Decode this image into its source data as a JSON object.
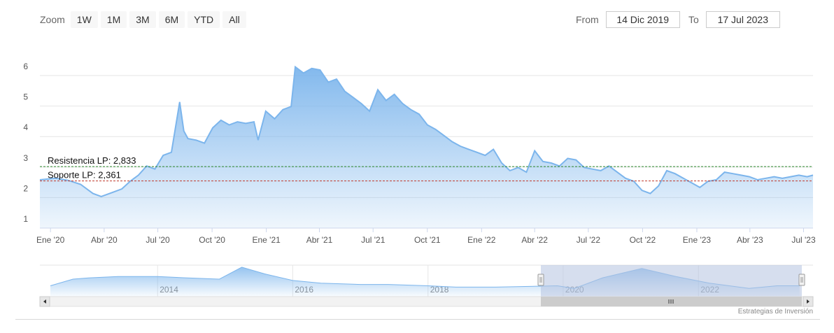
{
  "zoom": {
    "label": "Zoom",
    "buttons": [
      "1W",
      "1M",
      "3M",
      "6M",
      "YTD",
      "All"
    ]
  },
  "range": {
    "from_label": "From",
    "from_value": "14 Dic 2019",
    "to_label": "To",
    "to_value": "17 Jul 2023"
  },
  "credit": "Estrategias de Inversión",
  "colors": {
    "line": "#7cb5ec",
    "resistance": "#2e8b2e",
    "support": "#c0392b",
    "navigator_mask": "#b4c3e0"
  },
  "chart_data": {
    "type": "area",
    "title": "",
    "xlabel": "",
    "ylabel": "",
    "x_range": [
      "2019-12-14",
      "2023-07-17"
    ],
    "ylim": [
      1,
      6
    ],
    "yticks": [
      "1",
      "2",
      "3",
      "4",
      "5",
      "6"
    ],
    "xticks": [
      {
        "date": "2020-01-01",
        "label": "Ene '20"
      },
      {
        "date": "2020-04-01",
        "label": "Abr '20"
      },
      {
        "date": "2020-07-01",
        "label": "Jul '20"
      },
      {
        "date": "2020-10-01",
        "label": "Oct '20"
      },
      {
        "date": "2021-01-01",
        "label": "Ene '21"
      },
      {
        "date": "2021-04-01",
        "label": "Abr '21"
      },
      {
        "date": "2021-07-01",
        "label": "Jul '21"
      },
      {
        "date": "2021-10-01",
        "label": "Oct '21"
      },
      {
        "date": "2022-01-01",
        "label": "Ene '22"
      },
      {
        "date": "2022-04-01",
        "label": "Abr '22"
      },
      {
        "date": "2022-07-01",
        "label": "Jul '22"
      },
      {
        "date": "2022-10-01",
        "label": "Oct '22"
      },
      {
        "date": "2023-01-01",
        "label": "Ene '23"
      },
      {
        "date": "2023-04-01",
        "label": "Abr '23"
      },
      {
        "date": "2023-07-01",
        "label": "Jul '23"
      }
    ],
    "grid": true,
    "series": [
      {
        "points": [
          [
            "2019-12-14",
            2.4
          ],
          [
            "2020-01-10",
            2.45
          ],
          [
            "2020-01-31",
            2.38
          ],
          [
            "2020-02-21",
            2.25
          ],
          [
            "2020-03-13",
            1.95
          ],
          [
            "2020-03-27",
            1.85
          ],
          [
            "2020-04-17",
            2.0
          ],
          [
            "2020-05-01",
            2.1
          ],
          [
            "2020-05-15",
            2.35
          ],
          [
            "2020-05-29",
            2.55
          ],
          [
            "2020-06-12",
            2.85
          ],
          [
            "2020-06-26",
            2.75
          ],
          [
            "2020-07-10",
            3.2
          ],
          [
            "2020-07-24",
            3.3
          ],
          [
            "2020-08-07",
            4.95
          ],
          [
            "2020-08-14",
            4.0
          ],
          [
            "2020-08-21",
            3.75
          ],
          [
            "2020-09-04",
            3.7
          ],
          [
            "2020-09-18",
            3.6
          ],
          [
            "2020-10-02",
            4.1
          ],
          [
            "2020-10-16",
            4.35
          ],
          [
            "2020-10-30",
            4.2
          ],
          [
            "2020-11-13",
            4.3
          ],
          [
            "2020-11-27",
            4.25
          ],
          [
            "2020-12-11",
            4.3
          ],
          [
            "2020-12-18",
            3.7
          ],
          [
            "2020-12-31",
            4.65
          ],
          [
            "2021-01-15",
            4.4
          ],
          [
            "2021-01-29",
            4.7
          ],
          [
            "2021-02-12",
            4.8
          ],
          [
            "2021-02-19",
            6.1
          ],
          [
            "2021-03-05",
            5.9
          ],
          [
            "2021-03-19",
            6.05
          ],
          [
            "2021-04-02",
            6.0
          ],
          [
            "2021-04-16",
            5.6
          ],
          [
            "2021-04-30",
            5.7
          ],
          [
            "2021-05-14",
            5.3
          ],
          [
            "2021-05-28",
            5.1
          ],
          [
            "2021-06-11",
            4.9
          ],
          [
            "2021-06-25",
            4.65
          ],
          [
            "2021-07-09",
            5.35
          ],
          [
            "2021-07-23",
            5.0
          ],
          [
            "2021-08-06",
            5.2
          ],
          [
            "2021-08-20",
            4.9
          ],
          [
            "2021-09-03",
            4.7
          ],
          [
            "2021-09-17",
            4.55
          ],
          [
            "2021-10-01",
            4.2
          ],
          [
            "2021-10-15",
            4.05
          ],
          [
            "2021-10-29",
            3.85
          ],
          [
            "2021-11-12",
            3.65
          ],
          [
            "2021-11-26",
            3.5
          ],
          [
            "2021-12-10",
            3.4
          ],
          [
            "2021-12-24",
            3.3
          ],
          [
            "2022-01-07",
            3.2
          ],
          [
            "2022-01-21",
            3.4
          ],
          [
            "2022-02-04",
            2.95
          ],
          [
            "2022-02-18",
            2.7
          ],
          [
            "2022-03-04",
            2.8
          ],
          [
            "2022-03-18",
            2.65
          ],
          [
            "2022-04-01",
            3.35
          ],
          [
            "2022-04-15",
            3.0
          ],
          [
            "2022-04-29",
            2.95
          ],
          [
            "2022-05-13",
            2.85
          ],
          [
            "2022-05-27",
            3.1
          ],
          [
            "2022-06-10",
            3.05
          ],
          [
            "2022-06-24",
            2.8
          ],
          [
            "2022-07-08",
            2.75
          ],
          [
            "2022-07-22",
            2.7
          ],
          [
            "2022-08-05",
            2.85
          ],
          [
            "2022-08-19",
            2.65
          ],
          [
            "2022-09-02",
            2.45
          ],
          [
            "2022-09-16",
            2.35
          ],
          [
            "2022-09-30",
            2.05
          ],
          [
            "2022-10-14",
            1.95
          ],
          [
            "2022-10-28",
            2.2
          ],
          [
            "2022-11-11",
            2.7
          ],
          [
            "2022-11-25",
            2.6
          ],
          [
            "2022-12-09",
            2.45
          ],
          [
            "2022-12-23",
            2.3
          ],
          [
            "2023-01-06",
            2.15
          ],
          [
            "2023-01-20",
            2.35
          ],
          [
            "2023-02-03",
            2.4
          ],
          [
            "2023-02-17",
            2.65
          ],
          [
            "2023-03-03",
            2.6
          ],
          [
            "2023-03-17",
            2.55
          ],
          [
            "2023-03-31",
            2.5
          ],
          [
            "2023-04-14",
            2.4
          ],
          [
            "2023-04-28",
            2.45
          ],
          [
            "2023-05-12",
            2.5
          ],
          [
            "2023-05-26",
            2.45
          ],
          [
            "2023-06-09",
            2.5
          ],
          [
            "2023-06-23",
            2.55
          ],
          [
            "2023-07-07",
            2.5
          ],
          [
            "2023-07-17",
            2.55
          ]
        ]
      }
    ],
    "annotations": [
      {
        "label": "Resistencia LP: 2,833",
        "y": 2.833,
        "color": "#2e8b2e",
        "style": "dashed"
      },
      {
        "label": "Soporte LP: 2,361",
        "y": 2.361,
        "color": "#c0392b",
        "style": "dashed"
      }
    ],
    "navigator": {
      "tick_labels": [
        "2014",
        "2016",
        "2018",
        "2020",
        "2022"
      ],
      "selected_range": [
        "2019-12-14",
        "2023-07-17"
      ],
      "series": [
        [
          "2012-06-01",
          0.25
        ],
        [
          "2012-10-01",
          0.5
        ],
        [
          "2013-01-01",
          0.55
        ],
        [
          "2013-06-01",
          0.6
        ],
        [
          "2014-01-01",
          0.6
        ],
        [
          "2014-06-01",
          0.55
        ],
        [
          "2014-12-01",
          0.5
        ],
        [
          "2015-04-01",
          0.95
        ],
        [
          "2015-08-01",
          0.7
        ],
        [
          "2016-01-01",
          0.45
        ],
        [
          "2016-06-01",
          0.35
        ],
        [
          "2017-01-01",
          0.3
        ],
        [
          "2017-06-01",
          0.3
        ],
        [
          "2018-01-01",
          0.25
        ],
        [
          "2018-06-01",
          0.2
        ],
        [
          "2019-01-01",
          0.2
        ],
        [
          "2019-12-01",
          0.25
        ],
        [
          "2020-03-01",
          0.15
        ],
        [
          "2020-08-01",
          0.55
        ],
        [
          "2021-03-01",
          0.9
        ],
        [
          "2021-09-01",
          0.6
        ],
        [
          "2022-03-01",
          0.35
        ],
        [
          "2022-10-01",
          0.15
        ],
        [
          "2023-03-01",
          0.25
        ],
        [
          "2023-07-01",
          0.25
        ]
      ]
    }
  }
}
